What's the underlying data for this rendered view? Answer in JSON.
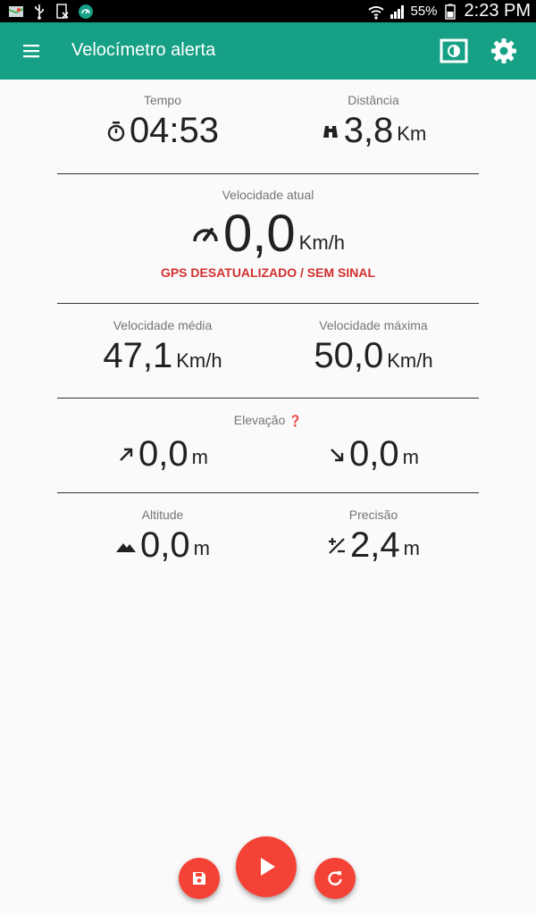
{
  "status_bar": {
    "battery": "55%",
    "time": "2:23 PM",
    "icons": [
      "map-icon",
      "usb-icon",
      "sim-off-icon",
      "speedometer-app-icon",
      "wifi-icon",
      "signal-icon",
      "battery-icon"
    ]
  },
  "toolbar": {
    "title": "Velocímetro alerta",
    "color": "#16a085",
    "icons": [
      "menu-icon",
      "display-mode-icon",
      "settings-icon"
    ]
  },
  "time_section": {
    "tempo_label": "Tempo",
    "tempo_value": "04:53",
    "distancia_label": "Distância",
    "distancia_value": "3,8",
    "distancia_unit": "Km"
  },
  "speed_section": {
    "label": "Velocidade atual",
    "value": "0,0",
    "unit": "Km/h",
    "warning": "GPS DESATUALIZADO / SEM SINAL",
    "warning_color": "#d32f2f"
  },
  "avg_max_section": {
    "media_label": "Velocidade média",
    "media_value": "47,1",
    "media_unit": "Km/h",
    "maxima_label": "Velocidade máxima",
    "maxima_value": "50,0",
    "maxima_unit": "Km/h"
  },
  "elevation_section": {
    "label": "Elevação",
    "help_icon": "❓",
    "up_value": "0,0",
    "up_unit": "m",
    "down_value": "0,0",
    "down_unit": "m"
  },
  "altitude_section": {
    "altitude_label": "Altitude",
    "altitude_value": "0,0",
    "altitude_unit": "m",
    "precisao_label": "Precisão",
    "precisao_value": "2,4",
    "precisao_unit": "m"
  },
  "fabs": {
    "accent": "#f44336",
    "icons": [
      "save-icon",
      "play-icon",
      "refresh-icon"
    ]
  }
}
